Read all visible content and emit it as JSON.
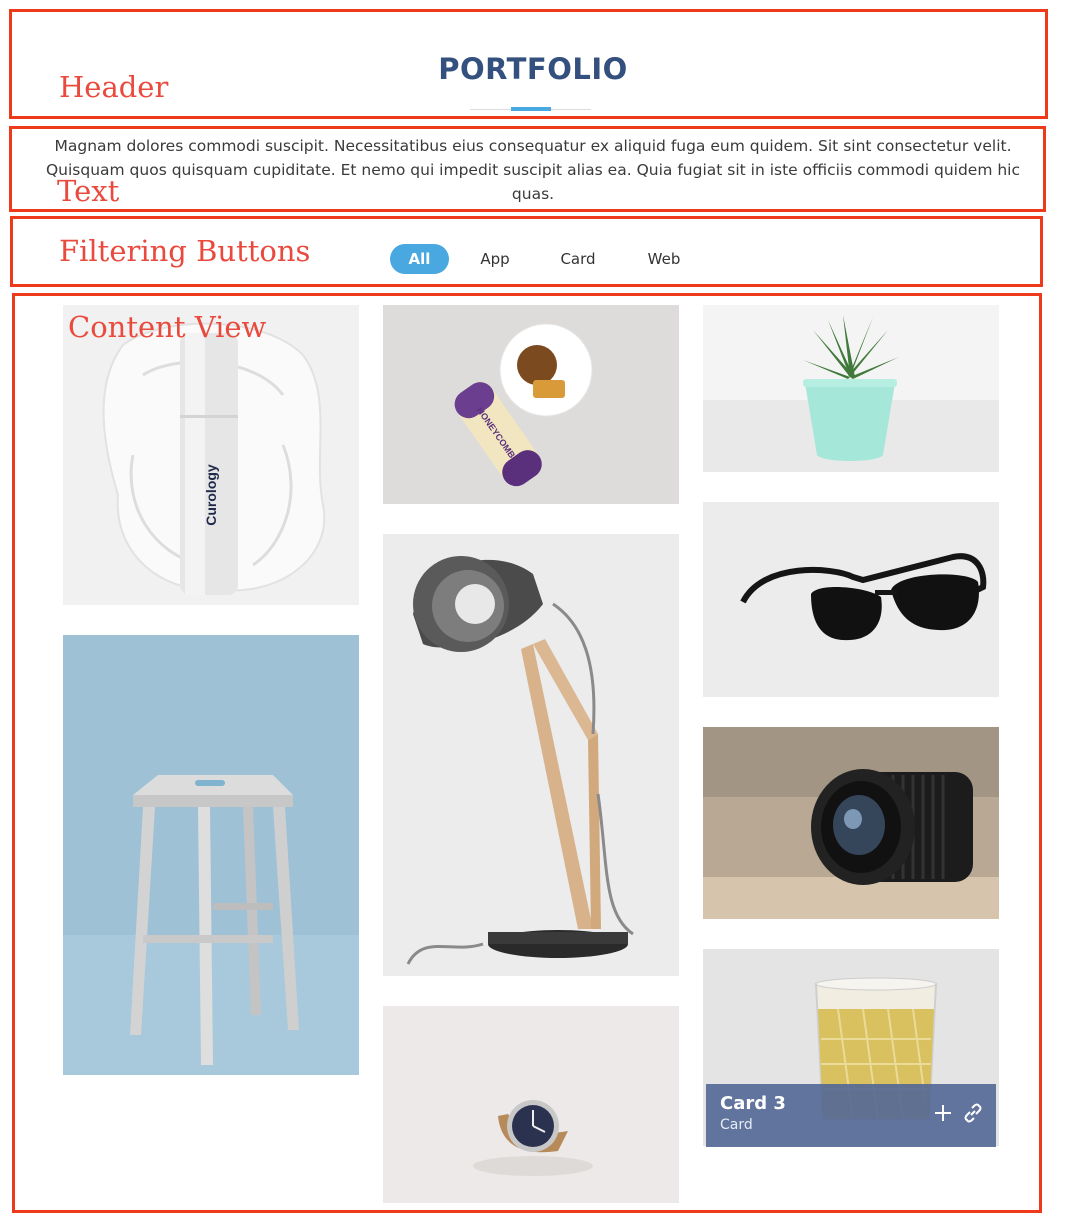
{
  "annotations": {
    "header": "Header",
    "text": "Text",
    "filtering": "Filtering Buttons",
    "content": "Content View"
  },
  "header": {
    "title": "PORTFOLIO"
  },
  "intro": {
    "text": "Magnam dolores commodi suscipit. Necessitatibus eius consequatur ex aliquid fuga eum quidem. Sit sint consectetur velit. Quisquam quos quisquam cupiditate. Et nemo qui impedit suscipit alias ea. Quia fugiat sit in iste officiis commodi quidem hic quas."
  },
  "filters": [
    {
      "label": "All",
      "active": true
    },
    {
      "label": "App",
      "active": false
    },
    {
      "label": "Card",
      "active": false
    },
    {
      "label": "Web",
      "active": false
    }
  ],
  "portfolio": {
    "items": [
      {
        "subject": "skincare bottle",
        "product_text": "Curology"
      },
      {
        "subject": "stool"
      },
      {
        "subject": "honeycomb tin and tea",
        "product_text": "HONEYCOMB"
      },
      {
        "subject": "desk lamp"
      },
      {
        "subject": "wrist watch"
      },
      {
        "subject": "potted succulent"
      },
      {
        "subject": "sunglasses"
      },
      {
        "subject": "camera lens"
      },
      {
        "subject": "glass of drink",
        "overlay_title": "Card 3",
        "overlay_category": "Card"
      }
    ]
  },
  "icons": {
    "plus": "plus-icon",
    "link": "link-icon"
  },
  "colors": {
    "accent": "#4aa8e0",
    "title": "#34507f",
    "annotation": "#ee3a1a",
    "overlay": "#526796"
  }
}
